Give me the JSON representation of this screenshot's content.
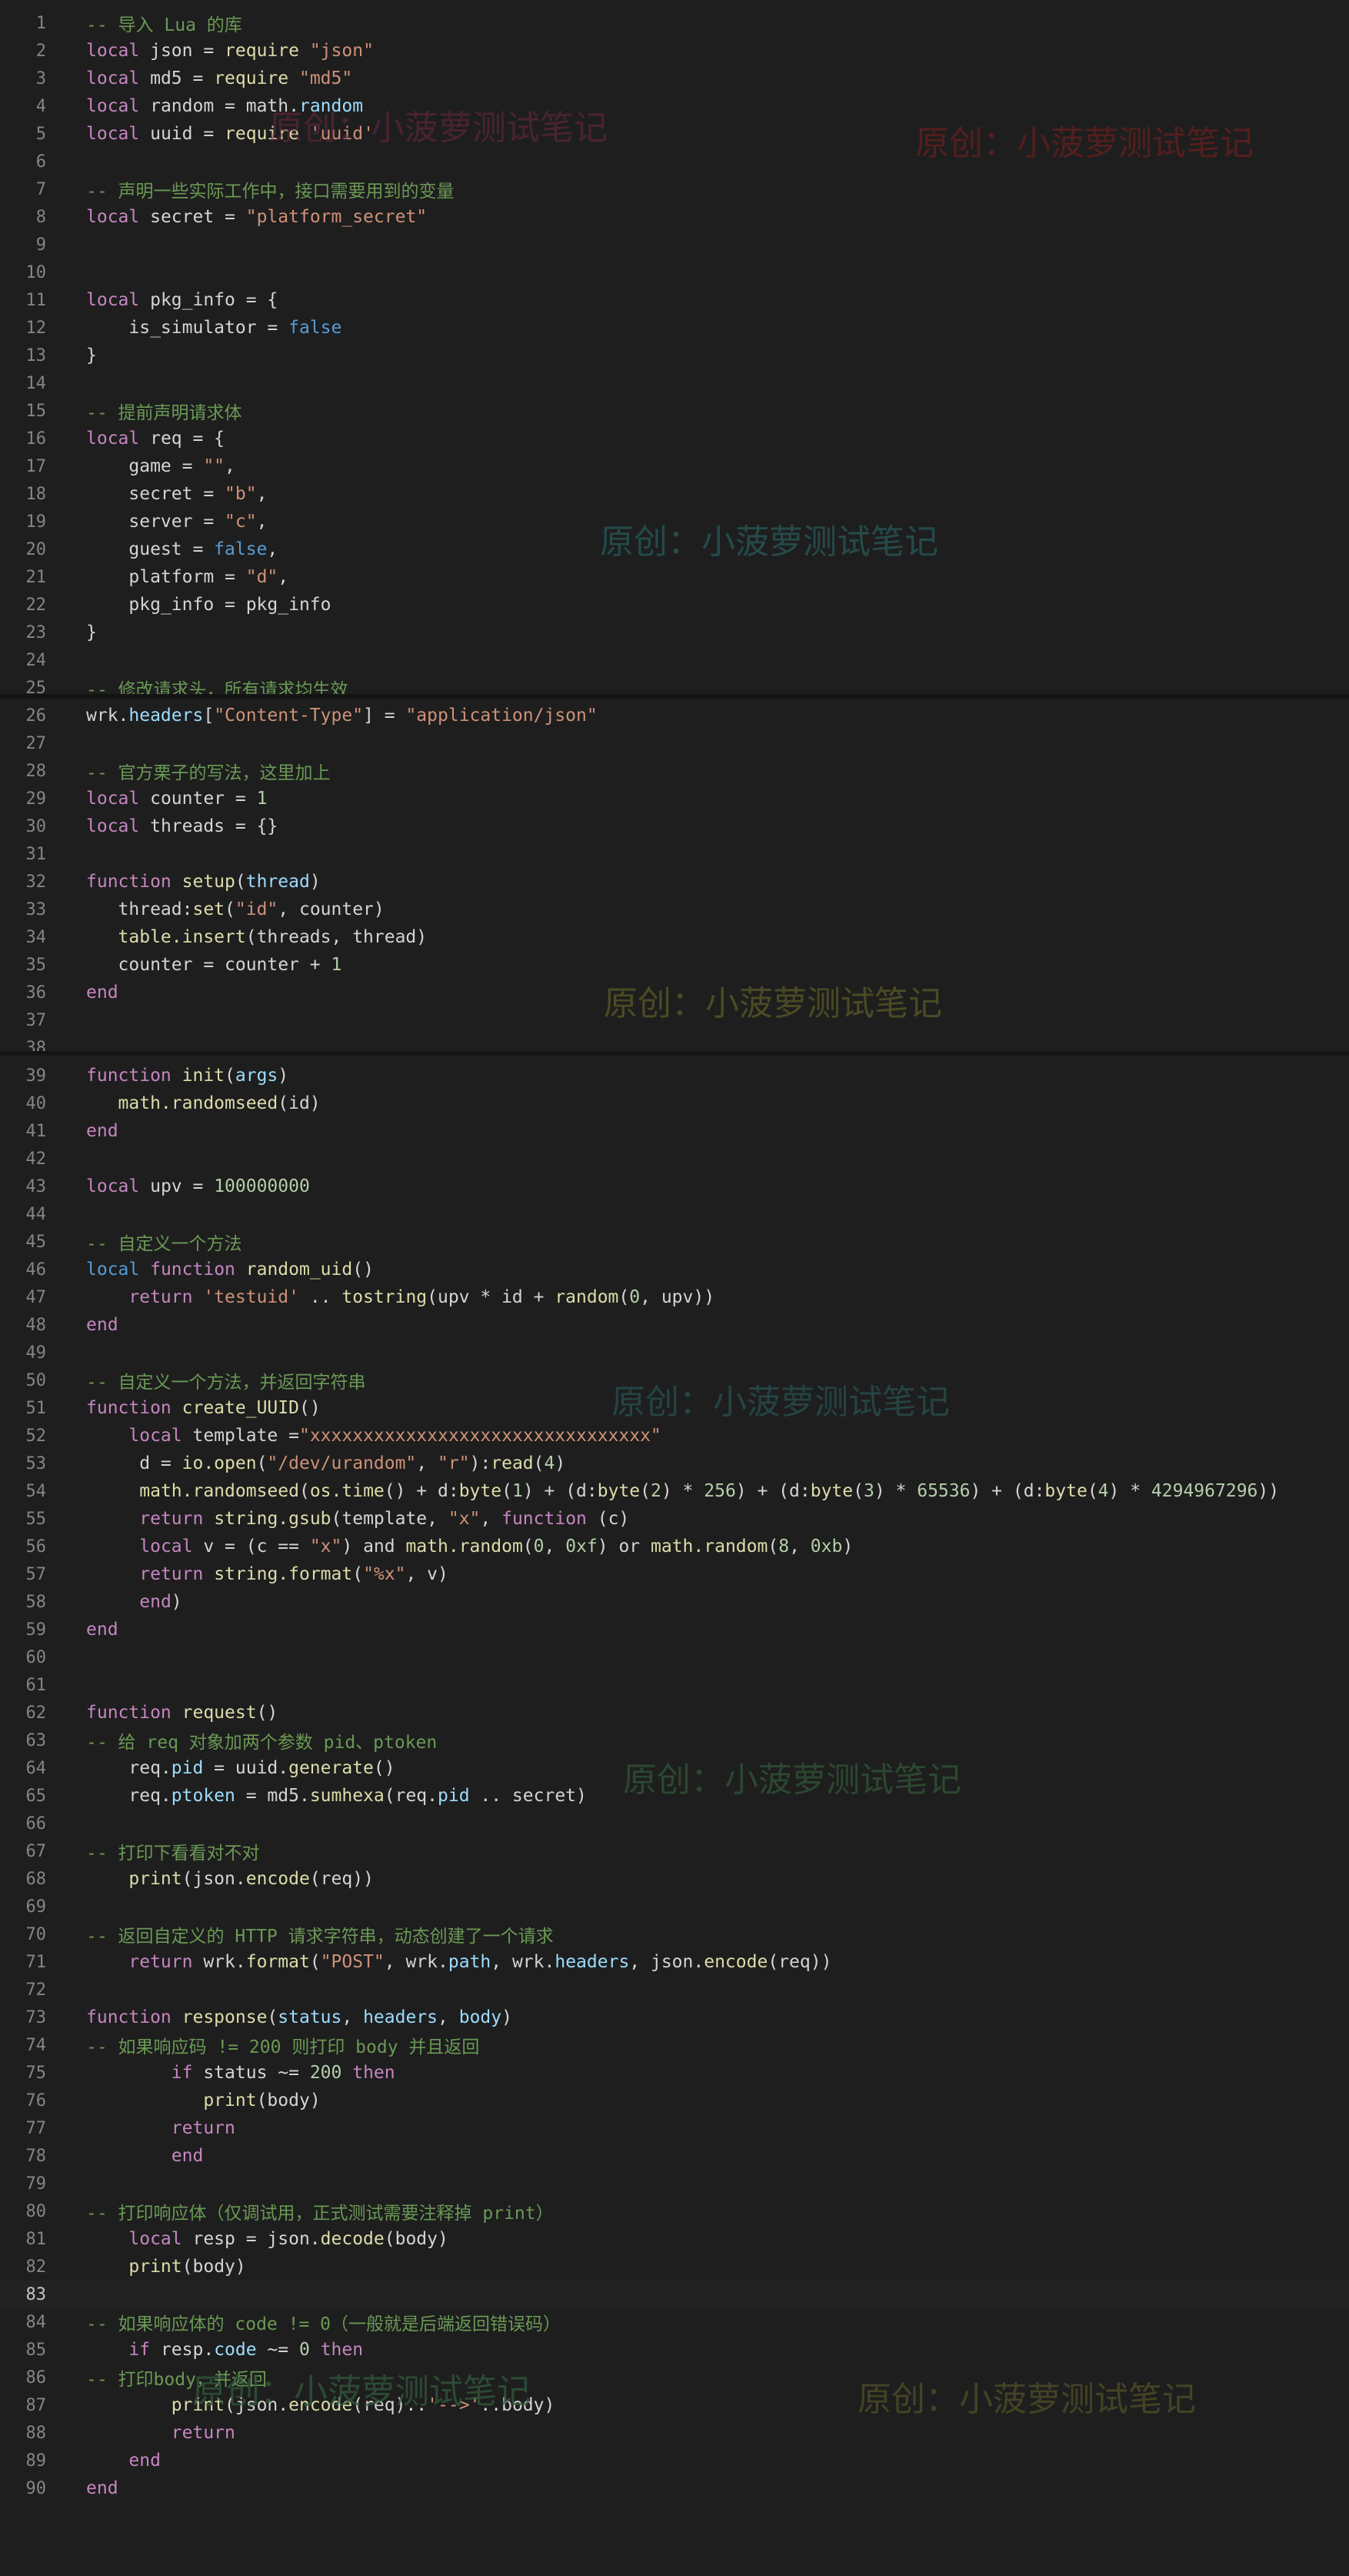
{
  "editor": {
    "lines": [
      [
        [
          "-- 导入 Lua 的库",
          "comment"
        ]
      ],
      [
        [
          "local",
          "keyword"
        ],
        [
          " json = ",
          "plain"
        ],
        [
          "require",
          "func"
        ],
        [
          " ",
          "plain"
        ],
        [
          "\"json\"",
          "string"
        ]
      ],
      [
        [
          "local",
          "keyword"
        ],
        [
          " md5 = ",
          "plain"
        ],
        [
          "require",
          "func"
        ],
        [
          " ",
          "plain"
        ],
        [
          "\"md5\"",
          "string"
        ]
      ],
      [
        [
          "local",
          "keyword"
        ],
        [
          " random = math.",
          "plain"
        ],
        [
          "random",
          "prop"
        ]
      ],
      [
        [
          "local",
          "keyword"
        ],
        [
          " uuid = ",
          "plain"
        ],
        [
          "require",
          "func"
        ],
        [
          " ",
          "plain"
        ],
        [
          "'uuid'",
          "string"
        ]
      ],
      [],
      [
        [
          "-- 声明一些实际工作中，接口需要用到的变量",
          "comment"
        ]
      ],
      [
        [
          "local",
          "keyword"
        ],
        [
          " secret = ",
          "plain"
        ],
        [
          "\"platform_secret\"",
          "string"
        ]
      ],
      [],
      [],
      [
        [
          "local",
          "keyword"
        ],
        [
          " pkg_info = {",
          "plain"
        ]
      ],
      [
        [
          "    is_simulator = ",
          "plain"
        ],
        [
          "false",
          "bool"
        ]
      ],
      [
        [
          "}",
          "plain"
        ]
      ],
      [],
      [
        [
          "-- 提前声明请求体",
          "comment"
        ]
      ],
      [
        [
          "local",
          "keyword"
        ],
        [
          " req = {",
          "plain"
        ]
      ],
      [
        [
          "    game = ",
          "plain"
        ],
        [
          "\"\"",
          "string"
        ],
        [
          ",",
          "plain"
        ]
      ],
      [
        [
          "    secret = ",
          "plain"
        ],
        [
          "\"b\"",
          "string"
        ],
        [
          ",",
          "plain"
        ]
      ],
      [
        [
          "    server = ",
          "plain"
        ],
        [
          "\"c\"",
          "string"
        ],
        [
          ",",
          "plain"
        ]
      ],
      [
        [
          "    guest = ",
          "plain"
        ],
        [
          "false",
          "bool"
        ],
        [
          ",",
          "plain"
        ]
      ],
      [
        [
          "    platform = ",
          "plain"
        ],
        [
          "\"d\"",
          "string"
        ],
        [
          ",",
          "plain"
        ]
      ],
      [
        [
          "    pkg_info = pkg_info",
          "plain"
        ]
      ],
      [
        [
          "}",
          "plain"
        ]
      ],
      [],
      [
        [
          "-- 修改请求头，所有请求均生效",
          "comment"
        ]
      ],
      [
        [
          "wrk.",
          "plain"
        ],
        [
          "headers",
          "prop"
        ],
        [
          "[",
          "plain"
        ],
        [
          "\"Content-Type\"",
          "string"
        ],
        [
          "] = ",
          "plain"
        ],
        [
          "\"application/json\"",
          "string"
        ]
      ],
      [],
      [
        [
          "-- 官方栗子的写法，这里加上",
          "comment"
        ]
      ],
      [
        [
          "local",
          "keyword"
        ],
        [
          " counter = ",
          "plain"
        ],
        [
          "1",
          "number"
        ]
      ],
      [
        [
          "local",
          "keyword"
        ],
        [
          " threads = {}",
          "plain"
        ]
      ],
      [],
      [
        [
          "function",
          "keyword"
        ],
        [
          " ",
          "plain"
        ],
        [
          "setup",
          "func"
        ],
        [
          "(",
          "plain"
        ],
        [
          "thread",
          "prop"
        ],
        [
          ")",
          "plain"
        ]
      ],
      [
        [
          "   thread:",
          "plain"
        ],
        [
          "set",
          "func"
        ],
        [
          "(",
          "plain"
        ],
        [
          "\"id\"",
          "string"
        ],
        [
          ", counter)",
          "plain"
        ]
      ],
      [
        [
          "   ",
          "plain"
        ],
        [
          "table.insert",
          "func"
        ],
        [
          "(threads, thread)",
          "plain"
        ]
      ],
      [
        [
          "   counter = counter + ",
          "plain"
        ],
        [
          "1",
          "number"
        ]
      ],
      [
        [
          "end",
          "keyword"
        ]
      ],
      [],
      [],
      [
        [
          "function",
          "keyword"
        ],
        [
          " ",
          "plain"
        ],
        [
          "init",
          "func"
        ],
        [
          "(",
          "plain"
        ],
        [
          "args",
          "prop"
        ],
        [
          ")",
          "plain"
        ]
      ],
      [
        [
          "   ",
          "plain"
        ],
        [
          "math.randomseed",
          "func"
        ],
        [
          "(id)",
          "plain"
        ]
      ],
      [
        [
          "end",
          "keyword"
        ]
      ],
      [],
      [
        [
          "local",
          "keyword"
        ],
        [
          " upv = ",
          "plain"
        ],
        [
          "100000000",
          "number"
        ]
      ],
      [],
      [
        [
          "-- 自定义一个方法",
          "comment"
        ]
      ],
      [
        [
          "local",
          "storage"
        ],
        [
          " ",
          "plain"
        ],
        [
          "function",
          "keyword"
        ],
        [
          " ",
          "plain"
        ],
        [
          "random_uid",
          "func"
        ],
        [
          "()",
          "plain"
        ]
      ],
      [
        [
          "    ",
          "plain"
        ],
        [
          "return",
          "keyword"
        ],
        [
          " ",
          "plain"
        ],
        [
          "'testuid'",
          "string"
        ],
        [
          " .. ",
          "plain"
        ],
        [
          "tostring",
          "func"
        ],
        [
          "(upv * id + ",
          "plain"
        ],
        [
          "random",
          "func"
        ],
        [
          "(",
          "plain"
        ],
        [
          "0",
          "number"
        ],
        [
          ", upv))",
          "plain"
        ]
      ],
      [
        [
          "end",
          "keyword"
        ]
      ],
      [],
      [
        [
          "-- 自定义一个方法，并返回字符串",
          "comment"
        ]
      ],
      [
        [
          "function",
          "keyword"
        ],
        [
          " ",
          "plain"
        ],
        [
          "create_UUID",
          "func"
        ],
        [
          "()",
          "plain"
        ]
      ],
      [
        [
          "    ",
          "plain"
        ],
        [
          "local",
          "keyword"
        ],
        [
          " template =",
          "plain"
        ],
        [
          "\"xxxxxxxxxxxxxxxxxxxxxxxxxxxxxxxx\"",
          "string"
        ]
      ],
      [
        [
          "     d = ",
          "plain"
        ],
        [
          "io.open",
          "func"
        ],
        [
          "(",
          "plain"
        ],
        [
          "\"/dev/urandom\"",
          "string"
        ],
        [
          ", ",
          "plain"
        ],
        [
          "\"r\"",
          "string"
        ],
        [
          "):",
          "plain"
        ],
        [
          "read",
          "func"
        ],
        [
          "(",
          "plain"
        ],
        [
          "4",
          "number"
        ],
        [
          ")",
          "plain"
        ]
      ],
      [
        [
          "     ",
          "plain"
        ],
        [
          "math.randomseed",
          "func"
        ],
        [
          "(",
          "plain"
        ],
        [
          "os.time",
          "func"
        ],
        [
          "() + d:",
          "plain"
        ],
        [
          "byte",
          "func"
        ],
        [
          "(",
          "plain"
        ],
        [
          "1",
          "number"
        ],
        [
          ") + (d:",
          "plain"
        ],
        [
          "byte",
          "func"
        ],
        [
          "(",
          "plain"
        ],
        [
          "2",
          "number"
        ],
        [
          ") * ",
          "plain"
        ],
        [
          "256",
          "number"
        ],
        [
          ") + (d:",
          "plain"
        ],
        [
          "byte",
          "func"
        ],
        [
          "(",
          "plain"
        ],
        [
          "3",
          "number"
        ],
        [
          ") * ",
          "plain"
        ],
        [
          "65536",
          "number"
        ],
        [
          ") + (d:",
          "plain"
        ],
        [
          "byte",
          "func"
        ],
        [
          "(",
          "plain"
        ],
        [
          "4",
          "number"
        ],
        [
          ") * ",
          "plain"
        ],
        [
          "4294967296",
          "number"
        ],
        [
          "))",
          "plain"
        ]
      ],
      [
        [
          "     ",
          "plain"
        ],
        [
          "return",
          "keyword"
        ],
        [
          " ",
          "plain"
        ],
        [
          "string.gsub",
          "func"
        ],
        [
          "(template, ",
          "plain"
        ],
        [
          "\"x\"",
          "string"
        ],
        [
          ", ",
          "plain"
        ],
        [
          "function",
          "keyword"
        ],
        [
          " (c)",
          "plain"
        ]
      ],
      [
        [
          "     ",
          "plain"
        ],
        [
          "local",
          "keyword"
        ],
        [
          " v = (c == ",
          "plain"
        ],
        [
          "\"x\"",
          "string"
        ],
        [
          ") and ",
          "plain"
        ],
        [
          "math.random",
          "func"
        ],
        [
          "(",
          "plain"
        ],
        [
          "0",
          "number"
        ],
        [
          ", ",
          "plain"
        ],
        [
          "0xf",
          "number"
        ],
        [
          ") or ",
          "plain"
        ],
        [
          "math.random",
          "func"
        ],
        [
          "(",
          "plain"
        ],
        [
          "8",
          "number"
        ],
        [
          ", ",
          "plain"
        ],
        [
          "0xb",
          "number"
        ],
        [
          ")",
          "plain"
        ]
      ],
      [
        [
          "     ",
          "plain"
        ],
        [
          "return",
          "keyword"
        ],
        [
          " ",
          "plain"
        ],
        [
          "string.format",
          "func"
        ],
        [
          "(",
          "plain"
        ],
        [
          "\"%x\"",
          "string"
        ],
        [
          ", v)",
          "plain"
        ]
      ],
      [
        [
          "     ",
          "plain"
        ],
        [
          "end",
          "keyword"
        ],
        [
          ")",
          "plain"
        ]
      ],
      [
        [
          "end",
          "keyword"
        ]
      ],
      [],
      [],
      [
        [
          "function",
          "keyword"
        ],
        [
          " ",
          "plain"
        ],
        [
          "request",
          "func"
        ],
        [
          "()",
          "plain"
        ]
      ],
      [
        [
          "-- 给 req 对象加两个参数 pid、ptoken",
          "comment"
        ]
      ],
      [
        [
          "    req.",
          "plain"
        ],
        [
          "pid",
          "prop"
        ],
        [
          " = uuid.",
          "plain"
        ],
        [
          "generate",
          "func"
        ],
        [
          "()",
          "plain"
        ]
      ],
      [
        [
          "    req.",
          "plain"
        ],
        [
          "ptoken",
          "prop"
        ],
        [
          " = md5.",
          "plain"
        ],
        [
          "sumhexa",
          "func"
        ],
        [
          "(req.",
          "plain"
        ],
        [
          "pid",
          "prop"
        ],
        [
          " .. secret)",
          "plain"
        ]
      ],
      [],
      [
        [
          "-- 打印下看看对不对",
          "comment"
        ]
      ],
      [
        [
          "    ",
          "plain"
        ],
        [
          "print",
          "func"
        ],
        [
          "(json.",
          "plain"
        ],
        [
          "encode",
          "func"
        ],
        [
          "(req))",
          "plain"
        ]
      ],
      [],
      [
        [
          "-- 返回自定义的 HTTP 请求字符串，动态创建了一个请求",
          "comment"
        ]
      ],
      [
        [
          "    ",
          "plain"
        ],
        [
          "return",
          "keyword"
        ],
        [
          " wrk.",
          "plain"
        ],
        [
          "format",
          "func"
        ],
        [
          "(",
          "plain"
        ],
        [
          "\"POST\"",
          "string"
        ],
        [
          ", wrk.",
          "plain"
        ],
        [
          "path",
          "prop"
        ],
        [
          ", wrk.",
          "plain"
        ],
        [
          "headers",
          "prop"
        ],
        [
          ", json.",
          "plain"
        ],
        [
          "encode",
          "func"
        ],
        [
          "(req))",
          "plain"
        ]
      ],
      [],
      [
        [
          "function",
          "keyword"
        ],
        [
          " ",
          "plain"
        ],
        [
          "response",
          "func"
        ],
        [
          "(",
          "plain"
        ],
        [
          "status",
          "prop"
        ],
        [
          ", ",
          "plain"
        ],
        [
          "headers",
          "prop"
        ],
        [
          ", ",
          "plain"
        ],
        [
          "body",
          "prop"
        ],
        [
          ")",
          "plain"
        ]
      ],
      [
        [
          "-- 如果响应码 != 200 则打印 body 并且返回",
          "comment"
        ]
      ],
      [
        [
          "        ",
          "plain"
        ],
        [
          "if",
          "keyword"
        ],
        [
          " status ~= ",
          "plain"
        ],
        [
          "200",
          "number"
        ],
        [
          " ",
          "plain"
        ],
        [
          "then",
          "keyword"
        ]
      ],
      [
        [
          "           ",
          "plain"
        ],
        [
          "print",
          "func"
        ],
        [
          "(body)",
          "plain"
        ]
      ],
      [
        [
          "        ",
          "plain"
        ],
        [
          "return",
          "keyword"
        ]
      ],
      [
        [
          "        ",
          "plain"
        ],
        [
          "end",
          "keyword"
        ]
      ],
      [],
      [
        [
          "-- 打印响应体（仅调试用，正式测试需要注释掉 print）",
          "comment"
        ]
      ],
      [
        [
          "    ",
          "plain"
        ],
        [
          "local",
          "keyword"
        ],
        [
          " resp = json.",
          "plain"
        ],
        [
          "decode",
          "func"
        ],
        [
          "(body)",
          "plain"
        ]
      ],
      [
        [
          "    ",
          "plain"
        ],
        [
          "print",
          "func"
        ],
        [
          "(",
          "plain"
        ],
        [
          "body",
          "plain"
        ],
        [
          ")",
          "plain"
        ]
      ],
      [],
      [
        [
          "-- 如果响应体的 code != 0（一般就是后端返回错误码）",
          "comment"
        ]
      ],
      [
        [
          "    ",
          "plain"
        ],
        [
          "if",
          "keyword"
        ],
        [
          " resp.",
          "plain"
        ],
        [
          "code",
          "prop"
        ],
        [
          " ~= ",
          "plain"
        ],
        [
          "0",
          "number"
        ],
        [
          " ",
          "plain"
        ],
        [
          "then",
          "keyword"
        ]
      ],
      [
        [
          "-- 打印body，并返回",
          "comment"
        ]
      ],
      [
        [
          "        ",
          "plain"
        ],
        [
          "print",
          "func"
        ],
        [
          "(json.",
          "plain"
        ],
        [
          "encode",
          "func"
        ],
        [
          "(req)..",
          "plain"
        ],
        [
          "'-->'",
          "string"
        ],
        [
          "..body)",
          "plain"
        ]
      ],
      [
        [
          "        ",
          "plain"
        ],
        [
          "return",
          "keyword"
        ]
      ],
      [
        [
          "    ",
          "plain"
        ],
        [
          "end",
          "keyword"
        ]
      ],
      [
        [
          "end",
          "keyword"
        ]
      ]
    ],
    "current_line": 83,
    "watermark_text": "原创：小菠萝测试笔记"
  },
  "colors": {
    "comment": "#6a9955",
    "keyword": "#c586c0",
    "string": "#ce9178",
    "number": "#b5cea8",
    "function": "#dcdcaa",
    "property": "#9cdcfe",
    "background": "#1e1e1e"
  }
}
